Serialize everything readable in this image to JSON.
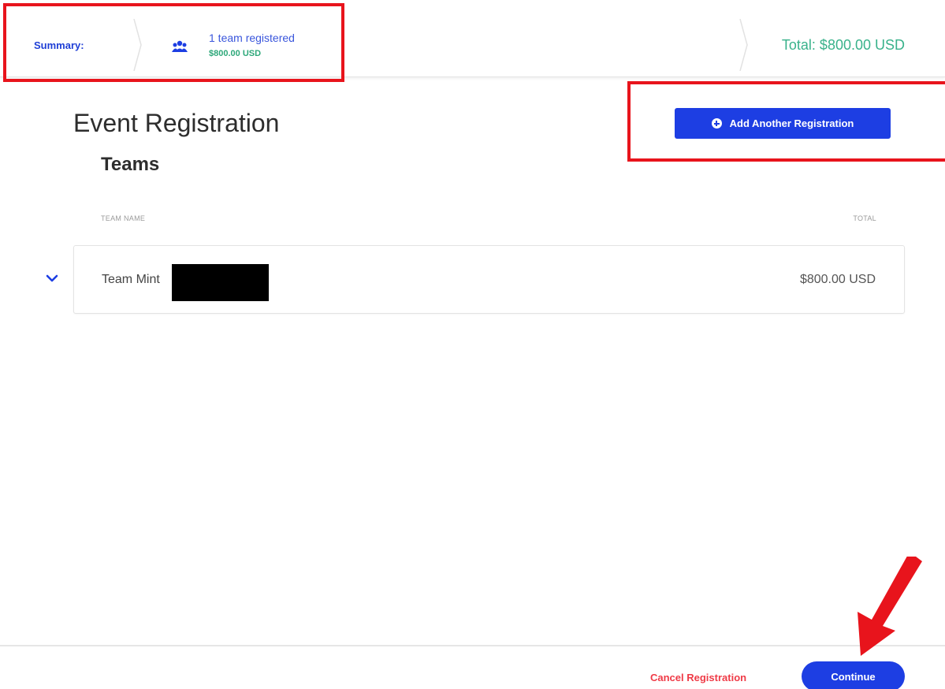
{
  "summary": {
    "label": "Summary:",
    "team_count_text": "1 team registered",
    "team_amount": "$800.00 USD",
    "total_text": "Total: $800.00 USD",
    "team_icon": "users-icon"
  },
  "main": {
    "title": "Event Registration",
    "section_title": "Teams",
    "add_button_label": "Add Another Registration",
    "add_button_icon": "plus-circle-icon"
  },
  "table": {
    "columns": [
      "TEAM NAME",
      "TOTAL"
    ],
    "rows": [
      {
        "team_name": "Team Mint",
        "total": "$800.00 USD"
      }
    ]
  },
  "footer": {
    "cancel_label": "Cancel Registration",
    "continue_label": "Continue"
  },
  "colors": {
    "primary": "#1d3ee3",
    "accent_green": "#39b28b",
    "cancel_red": "#ef3b47",
    "annotation_red": "#e8141c"
  }
}
